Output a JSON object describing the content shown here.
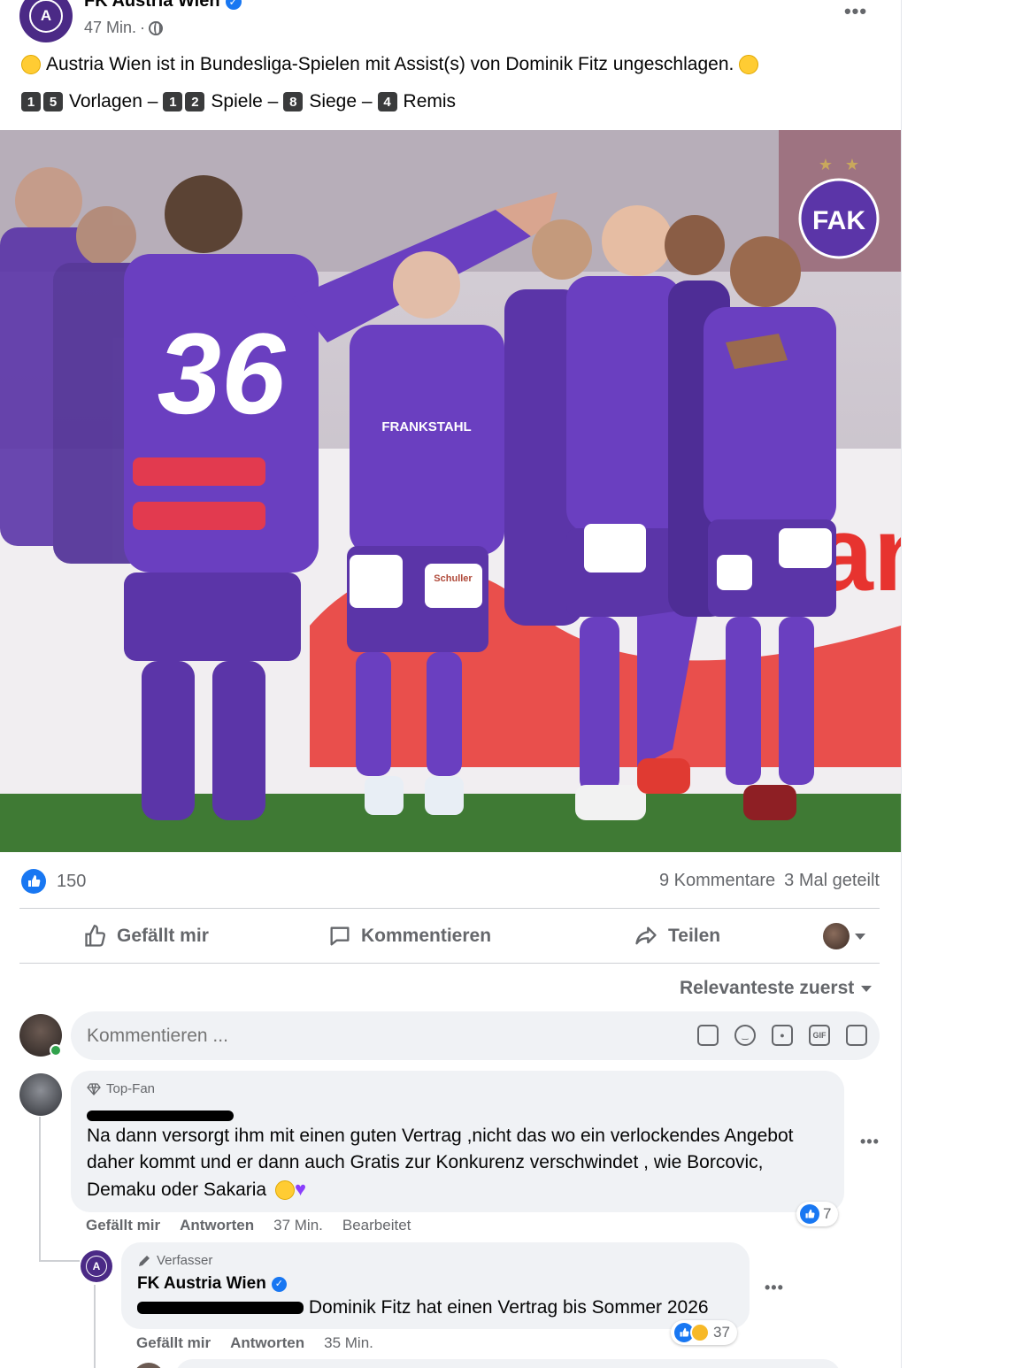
{
  "post": {
    "page_name": "FK Austria Wien",
    "time": "47 Min.",
    "separator": "·",
    "more": "•••",
    "text_line1": "Austria Wien ist in Bundesliga-Spielen mit Assist(s) von Dominik Fitz ungeschlagen.",
    "stats_line": {
      "n1": [
        "1",
        "5"
      ],
      "label1": "Vorlagen –",
      "n2": [
        "1",
        "2"
      ],
      "label2": "Spiele –",
      "n3": [
        "8"
      ],
      "label3": "Siege –",
      "n4": [
        "4"
      ],
      "label4": "Remis"
    },
    "photo": {
      "jersey_number": "36",
      "sponsor": "FRANKSTAHL",
      "shorts_sponsor": "Schuller",
      "club_badge": "FAK",
      "ad_board": "Manner"
    }
  },
  "stats": {
    "likes": "150",
    "comments": "9 Kommentare",
    "shares": "3 Mal geteilt"
  },
  "actions": {
    "like": "Gefällt mir",
    "comment": "Kommentieren",
    "share": "Teilen"
  },
  "sort": {
    "label": "Relevanteste zuerst"
  },
  "composer": {
    "placeholder": "Kommentieren ...",
    "icons": [
      "sticker-icon",
      "emoji-icon",
      "camera-icon",
      "gif-icon",
      "avatar-sticker-icon"
    ],
    "gif": "GIF"
  },
  "comments": [
    {
      "badge": "Top-Fan",
      "text": "Na dann versorgt ihm mit einen guten Vertrag ,nicht das wo ein verlockendes Angebot daher kommt und er dann auch Gratis zur Konkurenz verschwindet , wie Borcovic, Demaku oder Sakaria",
      "like": "Gefällt mir",
      "reply": "Antworten",
      "time": "37 Min.",
      "edited": "Bearbeitet",
      "reactions": "7"
    },
    {
      "badge": "Verfasser",
      "author": "FK Austria Wien",
      "text": "Dominik Fitz hat einen Vertrag bis Sommer 2026",
      "like": "Gefällt mir",
      "reply": "Antworten",
      "time": "35 Min.",
      "reactions": "37"
    }
  ],
  "colors": {
    "brand_blue": "#1877f2",
    "secondary_text": "#65676b",
    "bubble_bg": "#f0f2f5",
    "austria_purple": "#5b35a8"
  }
}
